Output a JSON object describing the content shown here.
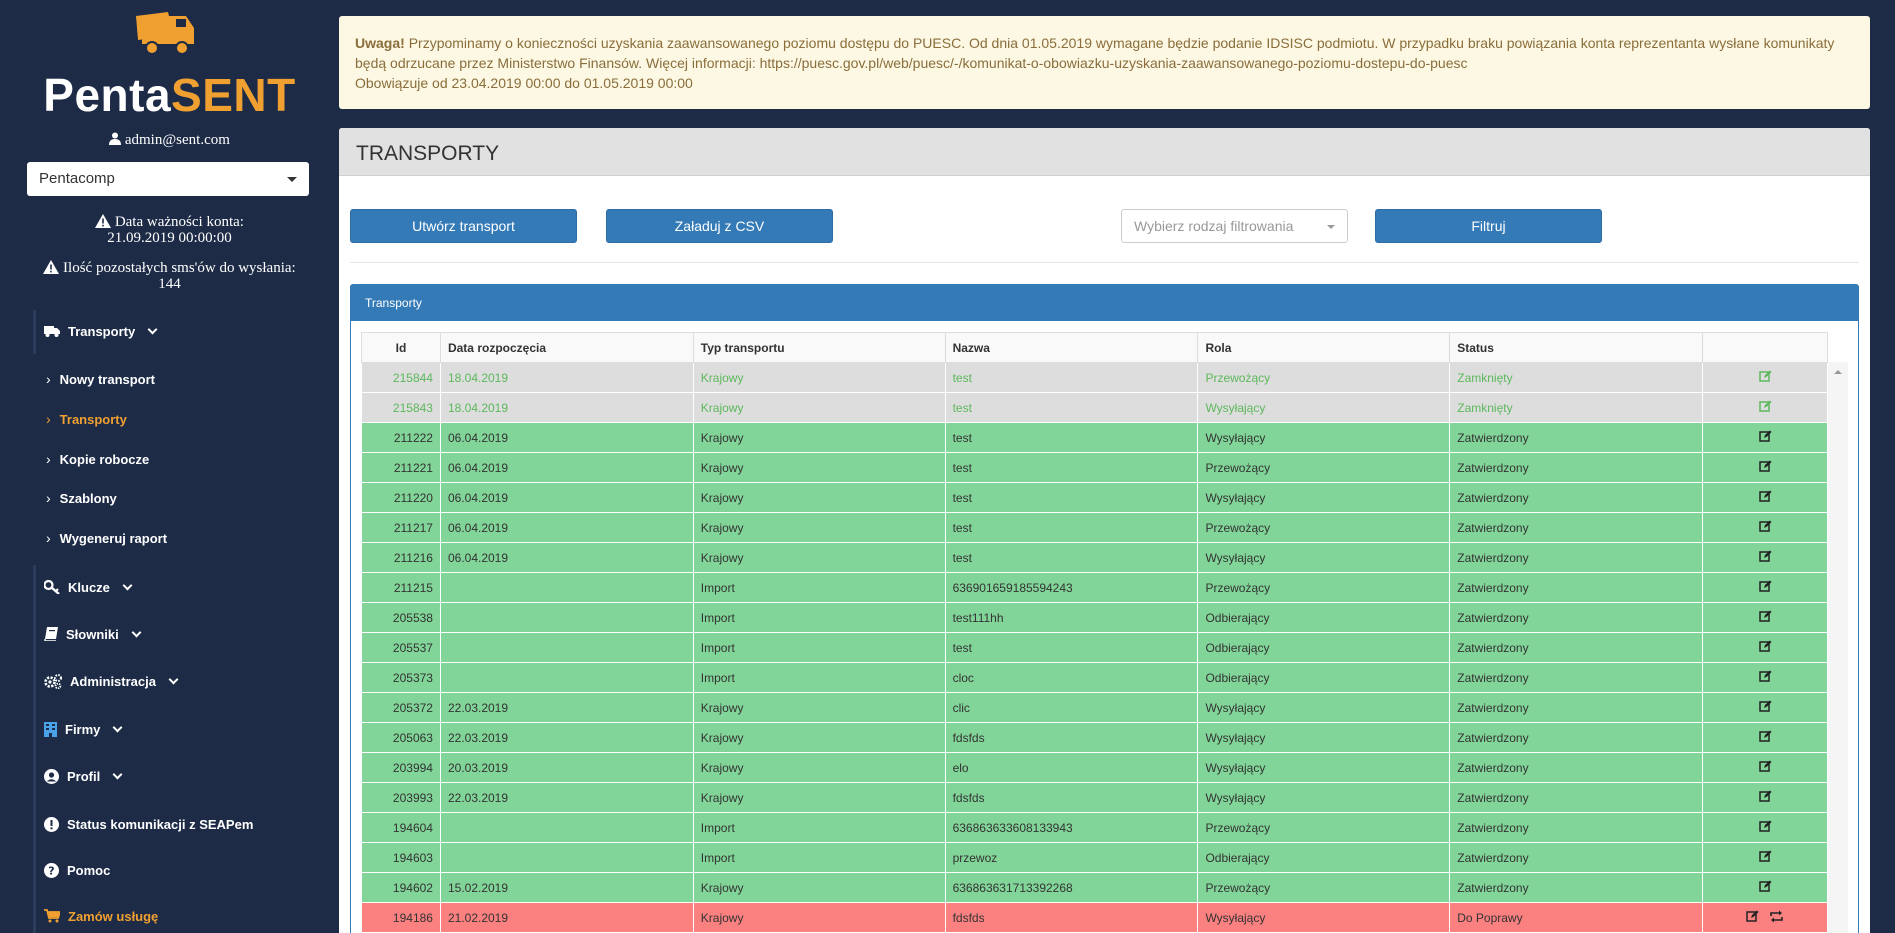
{
  "brand": {
    "name_part1": "Penta",
    "name_part2": "SENT",
    "accent_color": "#f0a030",
    "sidebar_bg": "#1d2b47",
    "logo_icon": "truck-icon"
  },
  "user": {
    "email": "admin@sent.com",
    "icon": "user-icon"
  },
  "company_select": {
    "value": "Pentacomp"
  },
  "account": {
    "validity_label": "Data ważności konta:",
    "validity_value": "21.09.2019 00:00:00",
    "sms_label": "Ilość pozostałych sms'ów do wysłania:",
    "sms_value": "144"
  },
  "nav": {
    "transporty": "Transporty",
    "sub": [
      "Nowy transport",
      "Transporty",
      "Kopie robocze",
      "Szablony",
      "Wygeneruj raport"
    ],
    "klucze": "Klucze",
    "slowniki": "Słowniki",
    "administracja": "Administracja",
    "firmy": "Firmy",
    "profil": "Profil",
    "status": "Status komunikacji z SEAPem",
    "pomoc": "Pomoc",
    "zamow": "Zamów usługę"
  },
  "notice": {
    "title": "Uwaga!",
    "text": "Przypominamy o konieczności uzyskania zaawansowanego poziomu dostępu do PUESC. Od dnia 01.05.2019 wymagane będzie podanie IDSISC podmiotu. W przypadku braku powiązania konta reprezentanta wysłane komunikaty będą odrzucane przez Ministerstwo Finansów. Więcej informacji: https://puesc.gov.pl/web/puesc/-/komunikat-o-obowiazku-uzyskania-zaawansowanego-poziomu-dostepu-do-puesc",
    "validity": "Obowiązuje od 23.04.2019 00:00 do 01.05.2019 00:00",
    "bg_color": "#fcf8e3"
  },
  "page": {
    "title": "TRANSPORTY",
    "btn_create": "Utwórz transport",
    "btn_csv": "Załaduj z CSV",
    "filter_placeholder": "Wybierz rodzaj filtrowania",
    "btn_filter": "Filtruj",
    "panel_title": "Transporty"
  },
  "table": {
    "headers": [
      "Id",
      "Data rozpoczęcia",
      "Typ transportu",
      "Nazwa",
      "Rola",
      "Status",
      ""
    ],
    "rows": [
      {
        "id": "215844",
        "date": "18.04.2019",
        "type": "Krajowy",
        "name": "test",
        "role": "Przewożący",
        "status": "Zamknięty",
        "state": "closed"
      },
      {
        "id": "215843",
        "date": "18.04.2019",
        "type": "Krajowy",
        "name": "test",
        "role": "Wysyłający",
        "status": "Zamknięty",
        "state": "closed"
      },
      {
        "id": "211222",
        "date": "06.04.2019",
        "type": "Krajowy",
        "name": "test",
        "role": "Wysyłający",
        "status": "Zatwierdzony",
        "state": "approved"
      },
      {
        "id": "211221",
        "date": "06.04.2019",
        "type": "Krajowy",
        "name": "test",
        "role": "Przewożący",
        "status": "Zatwierdzony",
        "state": "approved"
      },
      {
        "id": "211220",
        "date": "06.04.2019",
        "type": "Krajowy",
        "name": "test",
        "role": "Wysyłający",
        "status": "Zatwierdzony",
        "state": "approved"
      },
      {
        "id": "211217",
        "date": "06.04.2019",
        "type": "Krajowy",
        "name": "test",
        "role": "Przewożący",
        "status": "Zatwierdzony",
        "state": "approved"
      },
      {
        "id": "211216",
        "date": "06.04.2019",
        "type": "Krajowy",
        "name": "test",
        "role": "Wysyłający",
        "status": "Zatwierdzony",
        "state": "approved"
      },
      {
        "id": "211215",
        "date": "",
        "type": "Import",
        "name": "636901659185594243",
        "role": "Przewożący",
        "status": "Zatwierdzony",
        "state": "approved"
      },
      {
        "id": "205538",
        "date": "",
        "type": "Import",
        "name": "test111hh",
        "role": "Odbierający",
        "status": "Zatwierdzony",
        "state": "approved"
      },
      {
        "id": "205537",
        "date": "",
        "type": "Import",
        "name": "test",
        "role": "Odbierający",
        "status": "Zatwierdzony",
        "state": "approved"
      },
      {
        "id": "205373",
        "date": "",
        "type": "Import",
        "name": "cloc",
        "role": "Odbierający",
        "status": "Zatwierdzony",
        "state": "approved"
      },
      {
        "id": "205372",
        "date": "22.03.2019",
        "type": "Krajowy",
        "name": "clic",
        "role": "Wysyłający",
        "status": "Zatwierdzony",
        "state": "approved"
      },
      {
        "id": "205063",
        "date": "22.03.2019",
        "type": "Krajowy",
        "name": "fdsfds",
        "role": "Wysyłający",
        "status": "Zatwierdzony",
        "state": "approved"
      },
      {
        "id": "203994",
        "date": "20.03.2019",
        "type": "Krajowy",
        "name": "elo",
        "role": "Wysyłający",
        "status": "Zatwierdzony",
        "state": "approved"
      },
      {
        "id": "203993",
        "date": "22.03.2019",
        "type": "Krajowy",
        "name": "fdsfds",
        "role": "Wysyłający",
        "status": "Zatwierdzony",
        "state": "approved"
      },
      {
        "id": "194604",
        "date": "",
        "type": "Import",
        "name": "636863633608133943",
        "role": "Przewożący",
        "status": "Zatwierdzony",
        "state": "approved"
      },
      {
        "id": "194603",
        "date": "",
        "type": "Import",
        "name": "przewoz",
        "role": "Odbierający",
        "status": "Zatwierdzony",
        "state": "approved"
      },
      {
        "id": "194602",
        "date": "15.02.2019",
        "type": "Krajowy",
        "name": "636863631713392268",
        "role": "Przewożący",
        "status": "Zatwierdzony",
        "state": "approved"
      },
      {
        "id": "194186",
        "date": "21.02.2019",
        "type": "Krajowy",
        "name": "fdsfds",
        "role": "Wysyłający",
        "status": "Do Poprawy",
        "state": "fix"
      }
    ]
  },
  "colors": {
    "primary_button": "#337ab7",
    "row_closed": "#dddddd",
    "row_approved": "#82d598",
    "row_fix": "#fb8080"
  }
}
